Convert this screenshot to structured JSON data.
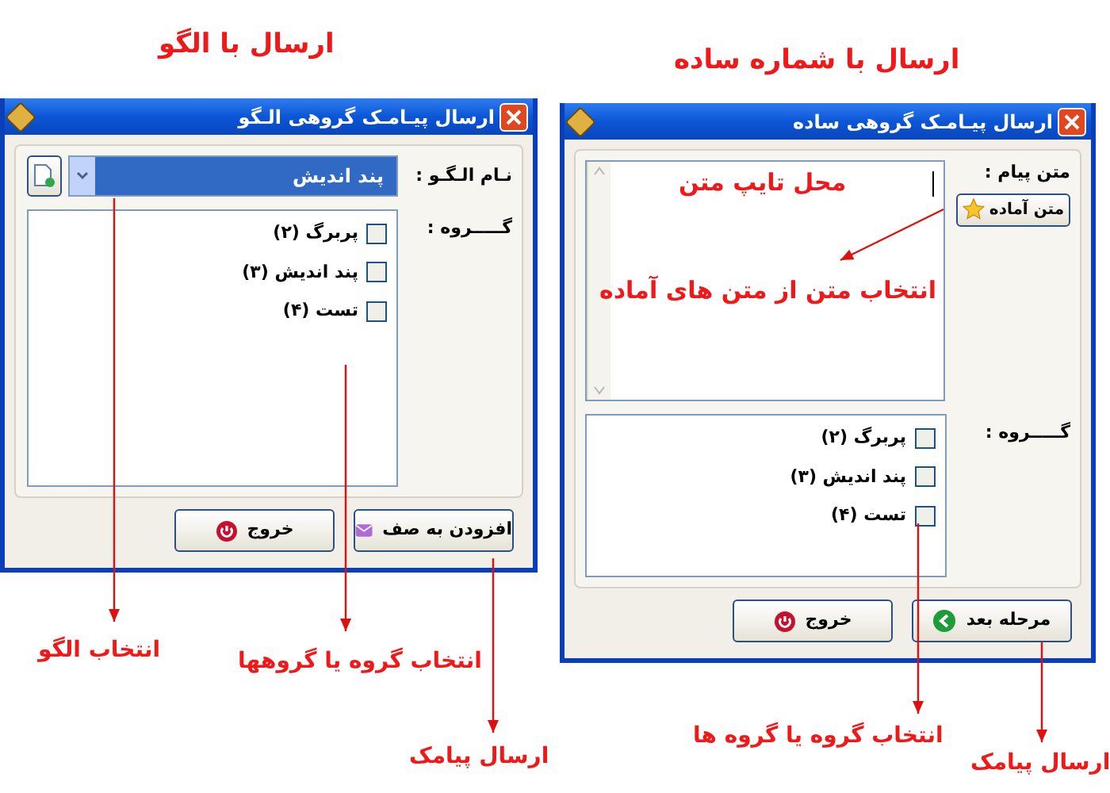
{
  "headings": [
    {
      "text": "ارسال با الگو"
    },
    {
      "text": "ارسال با شماره ساده"
    }
  ],
  "dialogs": [
    {
      "kind": "simple",
      "title": "ارسال پیـامـک گروهی ساده",
      "field_label": "متن پیام :",
      "ready_button": "متن آماده",
      "group_label": "گـــــروه :",
      "groups": [
        {
          "label": "پربرگ (۲)",
          "checked": false
        },
        {
          "label": "پند اندیش (۳)",
          "checked": false
        },
        {
          "label": "تست (۴)",
          "checked": false
        }
      ],
      "buttons": [
        {
          "label": "مرحله بعد",
          "kind": "next"
        },
        {
          "label": "خروج",
          "kind": "exit"
        }
      ]
    },
    {
      "kind": "template",
      "title": "ارسال پیـامـک گروهی الـگو",
      "field_label": "نـام الـگـو :",
      "field_value": "پند اندیش",
      "group_label": "گـــــروه :",
      "groups": [
        {
          "label": "پربرگ (۲)",
          "checked": false
        },
        {
          "label": "پند اندیش (۳)",
          "checked": false
        },
        {
          "label": "تست (۴)",
          "checked": false
        }
      ],
      "buttons": [
        {
          "label": "افزودن به صف",
          "kind": "queue"
        },
        {
          "label": "خروج",
          "kind": "exit"
        }
      ]
    }
  ],
  "annotations": [
    {
      "text": "محل تایپ متن"
    },
    {
      "text": "انتخاب متن از متن های آماده"
    },
    {
      "text": "انتخاب الگو"
    },
    {
      "text": "انتخاب گروه یا گروهها"
    },
    {
      "text": "ارسال پیامک"
    },
    {
      "text": "انتخاب گروه یا گروه ها"
    },
    {
      "text": "ارسال پیامک"
    }
  ]
}
